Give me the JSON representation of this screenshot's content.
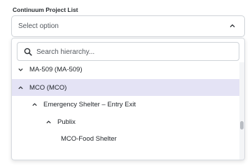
{
  "field": {
    "label": "Continuum Project List",
    "select_value": "Select option"
  },
  "search": {
    "placeholder": "Search hierarchy..."
  },
  "tree": {
    "items": [
      {
        "label": "MA-509 (MA-509)",
        "expanded": false
      },
      {
        "label": "MCO (MCO)",
        "expanded": true,
        "selected": true
      },
      {
        "label": "Emergency Shelter – Entry Exit",
        "expanded": true
      },
      {
        "label": "Publix",
        "expanded": true
      },
      {
        "label": "MCO-Food Shelter",
        "leaf": true
      }
    ]
  },
  "colors": {
    "selected_row": "#e4e3f5",
    "border": "#cfd3d8",
    "text": "#1f2328"
  }
}
